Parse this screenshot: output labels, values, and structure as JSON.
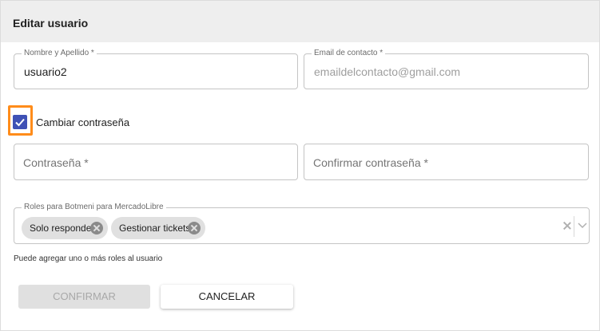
{
  "dialog": {
    "title": "Editar usuario"
  },
  "form": {
    "name": {
      "label": "Nombre y Apellido *",
      "value": "usuario2"
    },
    "email": {
      "label": "Email de contacto *",
      "value": "emaildelcontacto@gmail.com"
    },
    "change_password": {
      "label": "Cambiar contraseña",
      "checked": true
    },
    "password": {
      "placeholder": "Contraseña *"
    },
    "confirm_password": {
      "placeholder": "Confirmar contraseña *"
    },
    "roles": {
      "label": "Roles para Botmeni para MercadoLibre",
      "chips": [
        "Solo responder",
        "Gestionar tickets"
      ],
      "helper": "Puede agregar uno o más roles al usuario"
    }
  },
  "actions": {
    "confirm_label": "CONFIRMAR",
    "cancel_label": "CANCELAR"
  },
  "colors": {
    "accent": "#3f51b5",
    "highlight": "#ff8c1a"
  }
}
